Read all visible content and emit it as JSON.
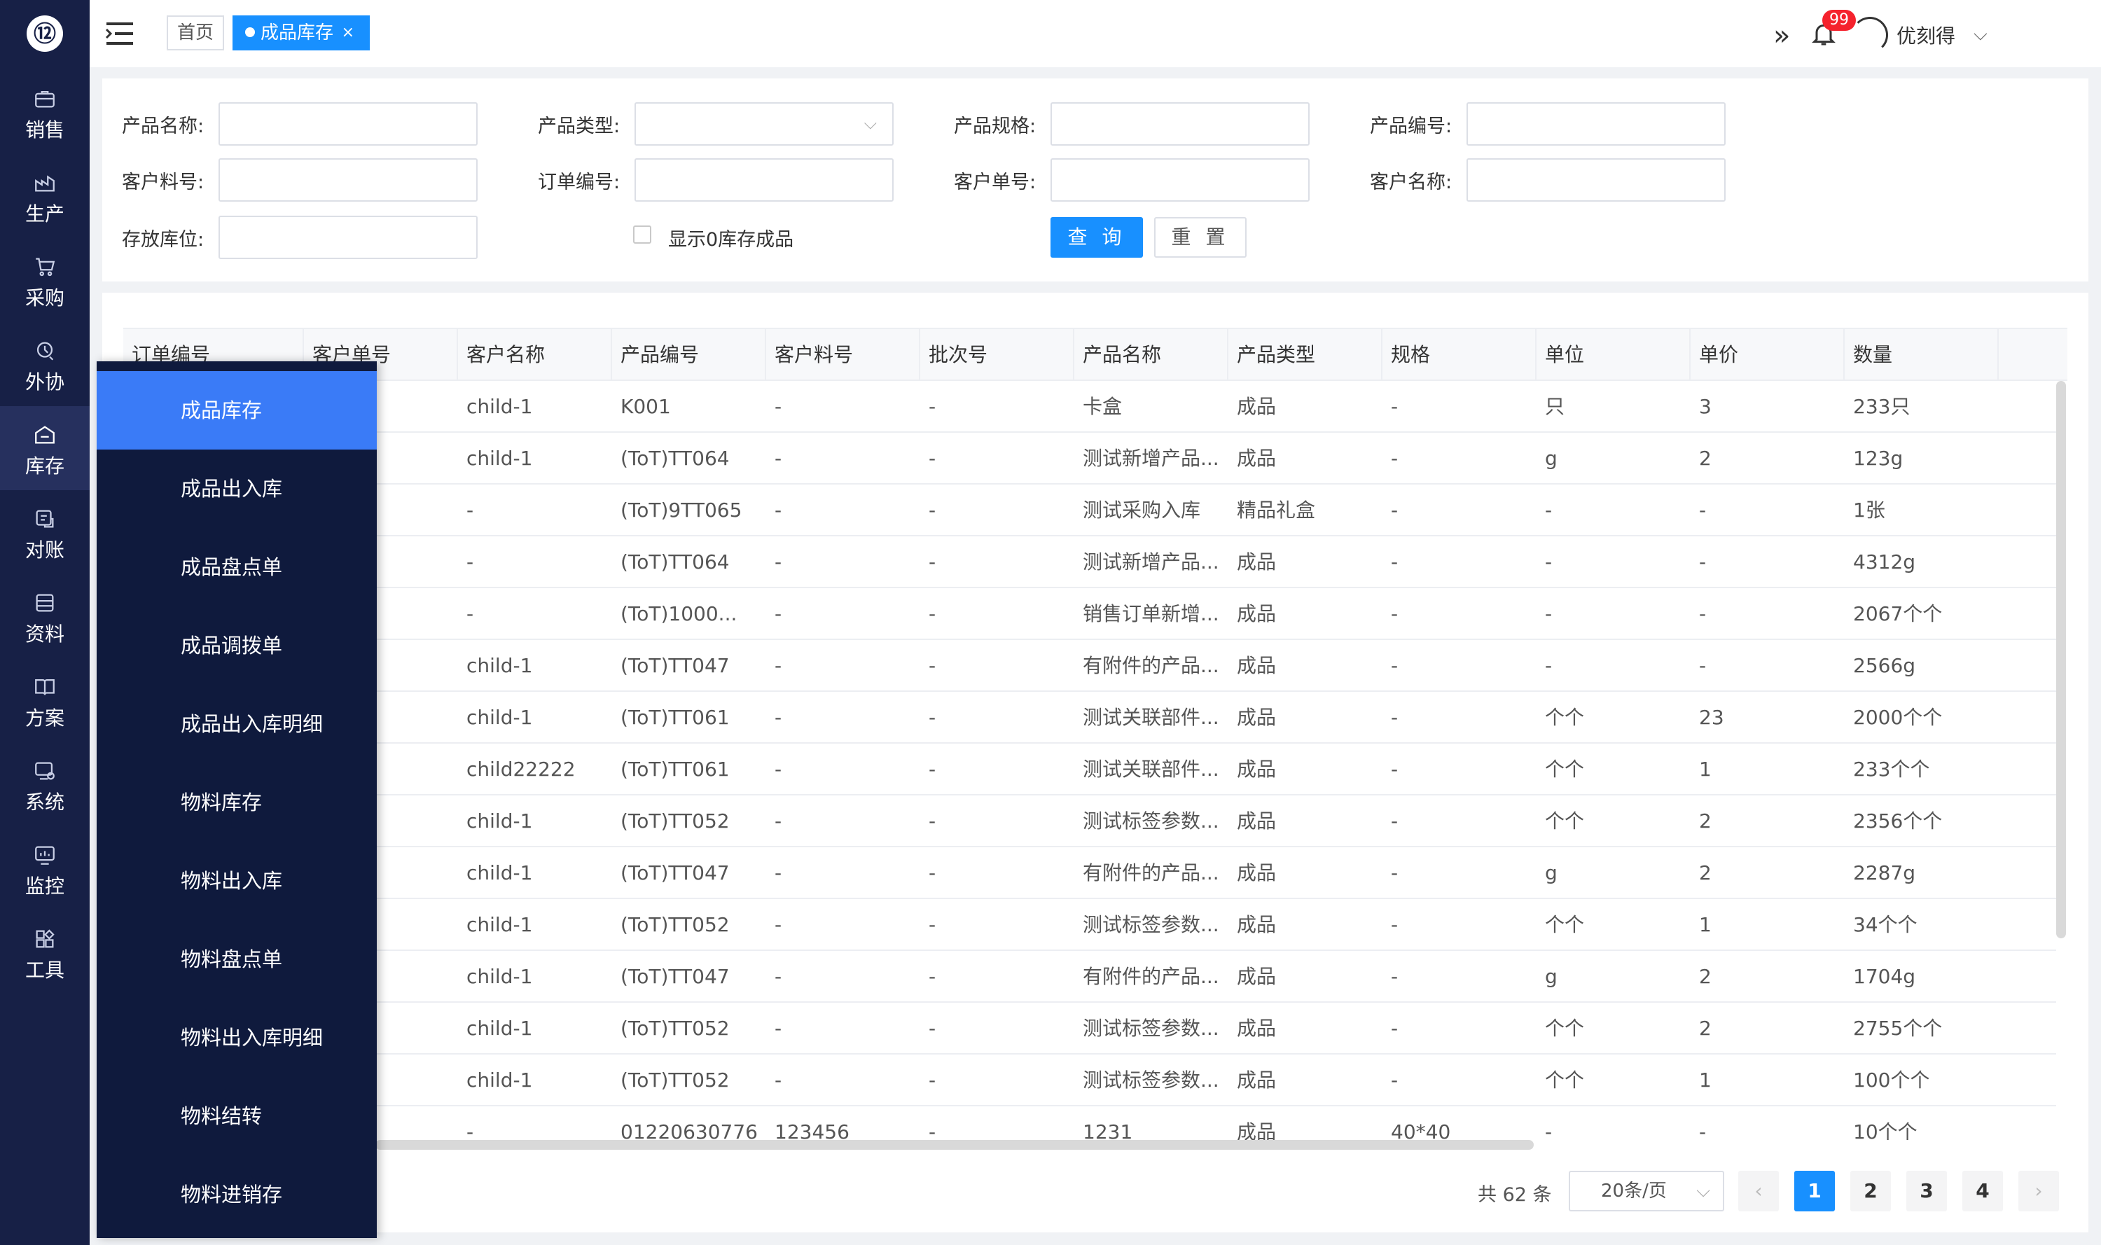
{
  "brand": {
    "logo_glyph": "⑫"
  },
  "nav": {
    "items": [
      {
        "label": "销售",
        "icon": "briefcase-icon"
      },
      {
        "label": "生产",
        "icon": "factory-icon"
      },
      {
        "label": "采购",
        "icon": "cart-icon"
      },
      {
        "label": "外协",
        "icon": "outsource-icon"
      },
      {
        "label": "库存",
        "icon": "warehouse-icon",
        "active": true
      },
      {
        "label": "对账",
        "icon": "reconcile-icon"
      },
      {
        "label": "资料",
        "icon": "data-icon"
      },
      {
        "label": "方案",
        "icon": "book-icon"
      },
      {
        "label": "系统",
        "icon": "system-icon"
      },
      {
        "label": "监控",
        "icon": "monitor-icon"
      },
      {
        "label": "工具",
        "icon": "tools-icon"
      }
    ]
  },
  "topbar": {
    "tabs": [
      {
        "label": "首页"
      },
      {
        "label": "成品库存",
        "close": "×",
        "active": true
      }
    ],
    "expand_glyph": "»",
    "notification_count": "99",
    "username": "优刻得",
    "user_caret": "⌵"
  },
  "filters": {
    "product_name_label": "产品名称:",
    "product_type_label": "产品类型:",
    "product_spec_label": "产品规格:",
    "product_code_label": "产品编号:",
    "customer_material_label": "客户料号:",
    "order_no_label": "订单编号:",
    "customer_order_label": "客户单号:",
    "customer_name_label": "客户名称:",
    "location_label": "存放库位:",
    "show_zero_label": "显示0库存成品",
    "query_button": "查 询",
    "reset_button": "重 置",
    "select_caret": "⌵"
  },
  "table": {
    "headers": [
      "订单编号",
      "客户单号",
      "客户名称",
      "产品编号",
      "客户料号",
      "批次号",
      "产品名称",
      "产品类型",
      "规格",
      "单位",
      "单价",
      "数量"
    ],
    "rows": [
      {
        "customer": "child-1",
        "code": "K001",
        "material": "-",
        "batch": "-",
        "name": "卡盒",
        "type": "成品",
        "spec": "-",
        "unit": "只",
        "price": "3",
        "qty": "233只"
      },
      {
        "customer": "child-1",
        "code": "(ToT)TT064",
        "material": "-",
        "batch": "-",
        "name": "测试新增产品...",
        "type": "成品",
        "spec": "-",
        "unit": "g",
        "price": "2",
        "qty": "123g"
      },
      {
        "customer": "-",
        "code": "(ToT)9TT065",
        "material": "-",
        "batch": "-",
        "name": "测试采购入库",
        "type": "精品礼盒",
        "spec": "-",
        "unit": "-",
        "price": "-",
        "qty": "1张"
      },
      {
        "customer": "-",
        "code": "(ToT)TT064",
        "material": "-",
        "batch": "-",
        "name": "测试新增产品...",
        "type": "成品",
        "spec": "-",
        "unit": "-",
        "price": "-",
        "qty": "4312g"
      },
      {
        "customer": "-",
        "code": "(ToT)1000...",
        "material": "-",
        "batch": "-",
        "name": "销售订单新增...",
        "type": "成品",
        "spec": "-",
        "unit": "-",
        "price": "-",
        "qty": "2067个个"
      },
      {
        "customer": "child-1",
        "code": "(ToT)TT047",
        "material": "-",
        "batch": "-",
        "name": "有附件的产品...",
        "type": "成品",
        "spec": "-",
        "unit": "-",
        "price": "-",
        "qty": "2566g"
      },
      {
        "customer": "child-1",
        "code": "(ToT)TT061",
        "material": "-",
        "batch": "-",
        "name": "测试关联部件...",
        "type": "成品",
        "spec": "-",
        "unit": "个个",
        "price": "23",
        "qty": "2000个个"
      },
      {
        "customer": "child22222",
        "code": "(ToT)TT061",
        "material": "-",
        "batch": "-",
        "name": "测试关联部件...",
        "type": "成品",
        "spec": "-",
        "unit": "个个",
        "price": "1",
        "qty": "233个个"
      },
      {
        "customer": "child-1",
        "code": "(ToT)TT052",
        "material": "-",
        "batch": "-",
        "name": "测试标签参数...",
        "type": "成品",
        "spec": "-",
        "unit": "个个",
        "price": "2",
        "qty": "2356个个"
      },
      {
        "customer": "child-1",
        "code": "(ToT)TT047",
        "material": "-",
        "batch": "-",
        "name": "有附件的产品...",
        "type": "成品",
        "spec": "-",
        "unit": "g",
        "price": "2",
        "qty": "2287g"
      },
      {
        "customer": "child-1",
        "code": "(ToT)TT052",
        "material": "-",
        "batch": "-",
        "name": "测试标签参数...",
        "type": "成品",
        "spec": "-",
        "unit": "个个",
        "price": "1",
        "qty": "34个个"
      },
      {
        "customer": "child-1",
        "code": "(ToT)TT047",
        "material": "-",
        "batch": "-",
        "name": "有附件的产品...",
        "type": "成品",
        "spec": "-",
        "unit": "g",
        "price": "2",
        "qty": "1704g"
      },
      {
        "customer": "child-1",
        "code": "(ToT)TT052",
        "material": "-",
        "batch": "-",
        "name": "测试标签参数...",
        "type": "成品",
        "spec": "-",
        "unit": "个个",
        "price": "2",
        "qty": "2755个个"
      },
      {
        "customer": "child-1",
        "code": "(ToT)TT052",
        "material": "-",
        "batch": "-",
        "name": "测试标签参数...",
        "type": "成品",
        "spec": "-",
        "unit": "个个",
        "price": "1",
        "qty": "100个个"
      },
      {
        "customer": "-",
        "code": "01220630776",
        "material": "123456",
        "batch": "-",
        "name": "1231",
        "type": "成品",
        "spec": "40*40",
        "unit": "-",
        "price": "-",
        "qty": "10个个"
      }
    ]
  },
  "pagination": {
    "total": "共 62 条",
    "page_size": "20条/页",
    "size_caret": "⌵",
    "prev": "‹",
    "next": "›",
    "pages": [
      "1",
      "2",
      "3",
      "4"
    ],
    "current": "1"
  },
  "submenu": {
    "items": [
      {
        "label": "成品库存",
        "active": true
      },
      {
        "label": "成品出入库"
      },
      {
        "label": "成品盘点单"
      },
      {
        "label": "成品调拨单"
      },
      {
        "label": "成品出入库明细"
      },
      {
        "label": "物料库存"
      },
      {
        "label": "物料出入库"
      },
      {
        "label": "物料盘点单"
      },
      {
        "label": "物料出入库明细"
      },
      {
        "label": "物料结转"
      },
      {
        "label": "物料进销存"
      }
    ]
  },
  "colors": {
    "sidebar": "#172046",
    "flyout": "#0f1a3d",
    "accent": "#1890ff",
    "flyout_active": "#3a7bf7",
    "badge": "#f5222d"
  }
}
